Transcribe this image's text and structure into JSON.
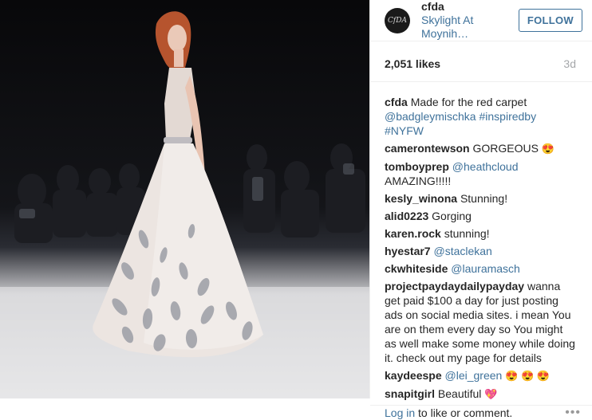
{
  "header": {
    "username": "cfda",
    "location": "Skylight At Moynih…",
    "follow_label": "FOLLOW",
    "avatar_text": "CfDA"
  },
  "stats": {
    "likes": "2,051 likes",
    "age": "3d"
  },
  "comments": [
    {
      "user": "cfda",
      "text": "Made for the red carpet",
      "tags": "@badgleymischka #inspiredby #NYFW"
    },
    {
      "user": "camerontewson",
      "text": "GORGEOUS",
      "emoji": "😍"
    },
    {
      "user": "tomboyprep",
      "tag": "@heathcloud",
      "text": "AMAZING!!!!!"
    },
    {
      "user": "kesly_winona",
      "text": "Stunning!"
    },
    {
      "user": "alid0223",
      "text": "Gorging"
    },
    {
      "user": "karen.rock",
      "text": "stunning!"
    },
    {
      "user": "hyestar7",
      "tag": "@staclekan"
    },
    {
      "user": "ckwhiteside",
      "tag": "@lauramasch"
    },
    {
      "user": "projectpaydaydailypayday",
      "text": "wanna get paid $100 a day for just posting ads on social media sites. i mean You are on them every day so You might as well make some money while doing it. check out my page for details"
    },
    {
      "user": "kaydeespe",
      "tag": "@lei_green",
      "emoji": "😍 😍 😍"
    },
    {
      "user": "snapitgirl",
      "text": "Beautiful",
      "emoji": "💖"
    }
  ],
  "footer": {
    "login_link": "Log in",
    "login_suffix": "to like or comment.",
    "more_icon": "•••"
  },
  "colors": {
    "link": "#3f729b",
    "text": "#262626",
    "muted": "#a5a7aa"
  }
}
